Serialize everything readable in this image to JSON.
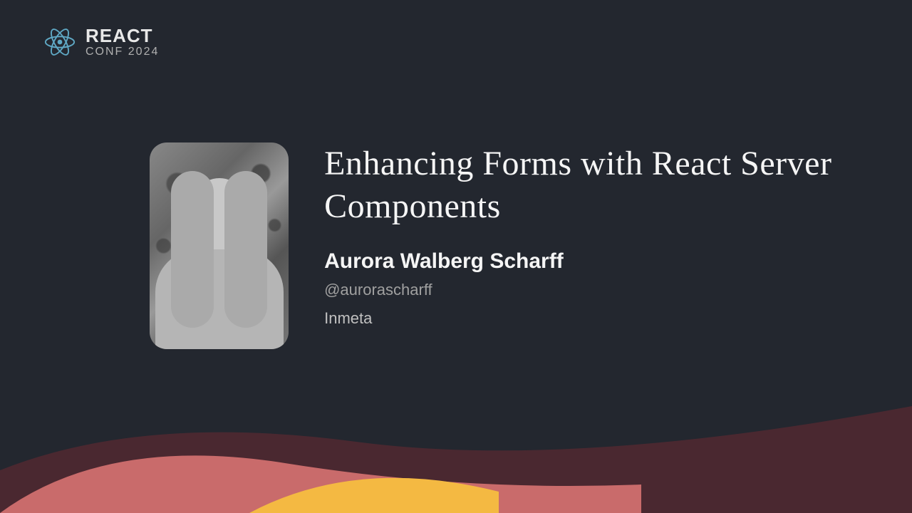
{
  "logo": {
    "title": "REACT",
    "subtitle": "CONF 2024"
  },
  "talk": {
    "title": "Enhancing Forms with React Server Components"
  },
  "speaker": {
    "name": "Aurora Walberg Scharff",
    "handle": "@aurorascharff",
    "company": "Inmeta"
  },
  "colors": {
    "background": "#23272f",
    "wave_dark": "#4a2830",
    "wave_coral": "#c96b6b",
    "wave_yellow": "#f4b942",
    "react_cyan": "#61dafb"
  }
}
